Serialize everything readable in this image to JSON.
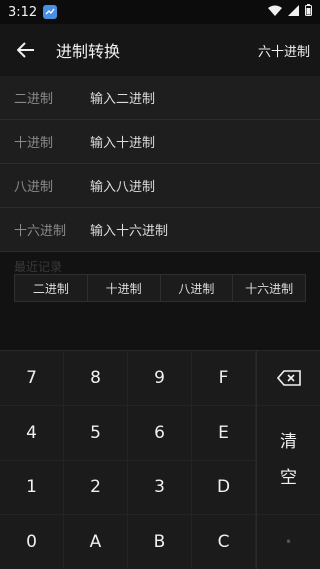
{
  "status_bar": {
    "time": "3:12"
  },
  "app_bar": {
    "title": "进制转换",
    "mode_button": "六十进制"
  },
  "fields": [
    {
      "label": "二进制",
      "placeholder": "输入二进制"
    },
    {
      "label": "十进制",
      "placeholder": "输入十进制"
    },
    {
      "label": "八进制",
      "placeholder": "输入八进制"
    },
    {
      "label": "十六进制",
      "placeholder": "输入十六进制"
    }
  ],
  "history": {
    "title": "最近记录",
    "tabs": [
      "二进制",
      "十进制",
      "八进制",
      "十六进制"
    ]
  },
  "keypad": {
    "keys": [
      "7",
      "8",
      "9",
      "F",
      "4",
      "5",
      "6",
      "E",
      "1",
      "2",
      "3",
      "D",
      "0",
      "A",
      "B",
      "C"
    ],
    "clear_top": "清",
    "clear_bottom": "空",
    "dot": "•"
  },
  "colors": {
    "background": "#121212",
    "panel": "#1e1e1e",
    "keypad": "#1b1b1b",
    "text": "#f0f0f0",
    "muted": "#8a8a8a"
  },
  "icons": {
    "back": "arrow-left-icon",
    "backspace": "backspace-icon",
    "wifi": "wifi-icon",
    "signal": "signal-icon",
    "battery": "battery-icon"
  }
}
